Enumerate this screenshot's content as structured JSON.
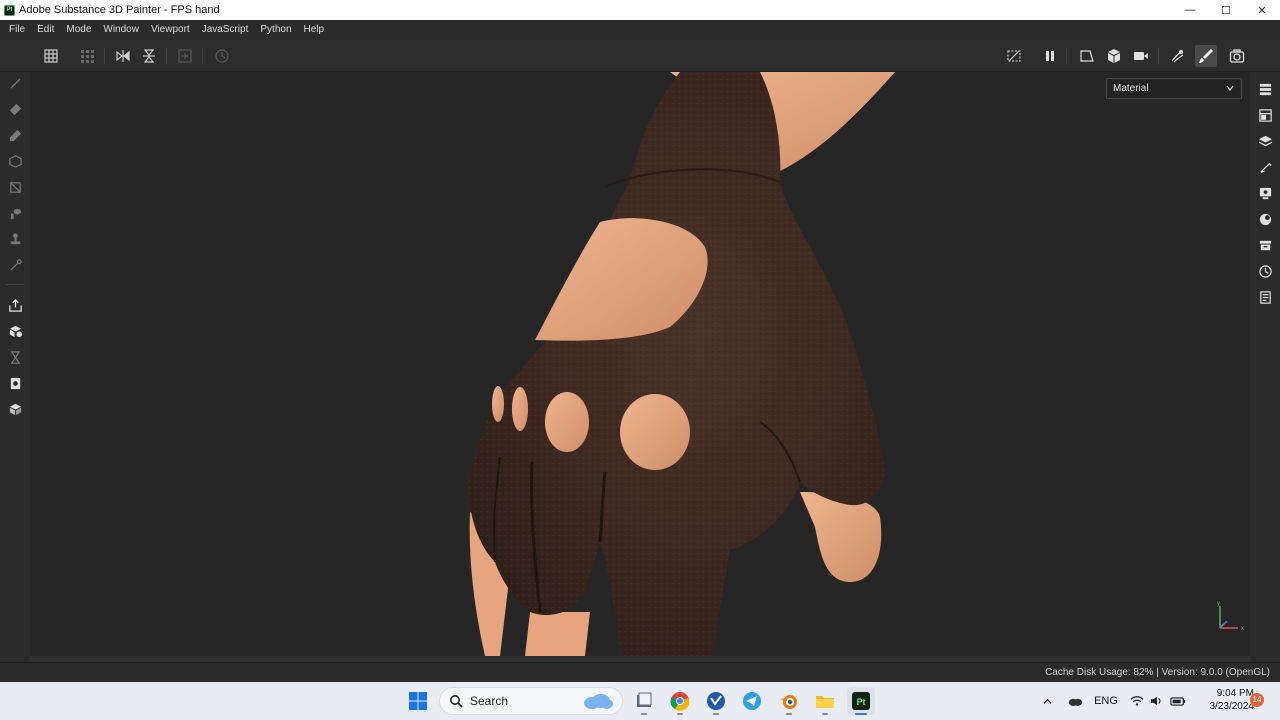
{
  "window": {
    "title": "Adobe Substance 3D Painter - FPS hand",
    "logo_text": "Pt",
    "controls": {
      "minimize": "—",
      "maximize": "☐",
      "close": "✕"
    }
  },
  "menu": [
    "File",
    "Edit",
    "Mode",
    "Window",
    "Viewport",
    "JavaScript",
    "Python",
    "Help"
  ],
  "viewport": {
    "display_mode": "Material",
    "axis_labels": {
      "y": "y",
      "x": "x"
    }
  },
  "status": {
    "text": "Cache Disk Usage:  82% | Version: 9.0.0 (OpenGL)"
  },
  "taskbar": {
    "search_label": "Search",
    "language": "ENG",
    "time": "9:04 PM",
    "date": "3/23/2024",
    "notification_count": "14",
    "pinned_apps": [
      "start-icon",
      "file-explorer-app-icon",
      "chrome-icon",
      "vscode-like-icon",
      "telegram-icon",
      "blender-icon",
      "folder-icon",
      "substance-painter-icon"
    ]
  },
  "colors": {
    "accent": "#2c7be5",
    "glove": "#3f2a22",
    "skin": "#e1a07c"
  }
}
